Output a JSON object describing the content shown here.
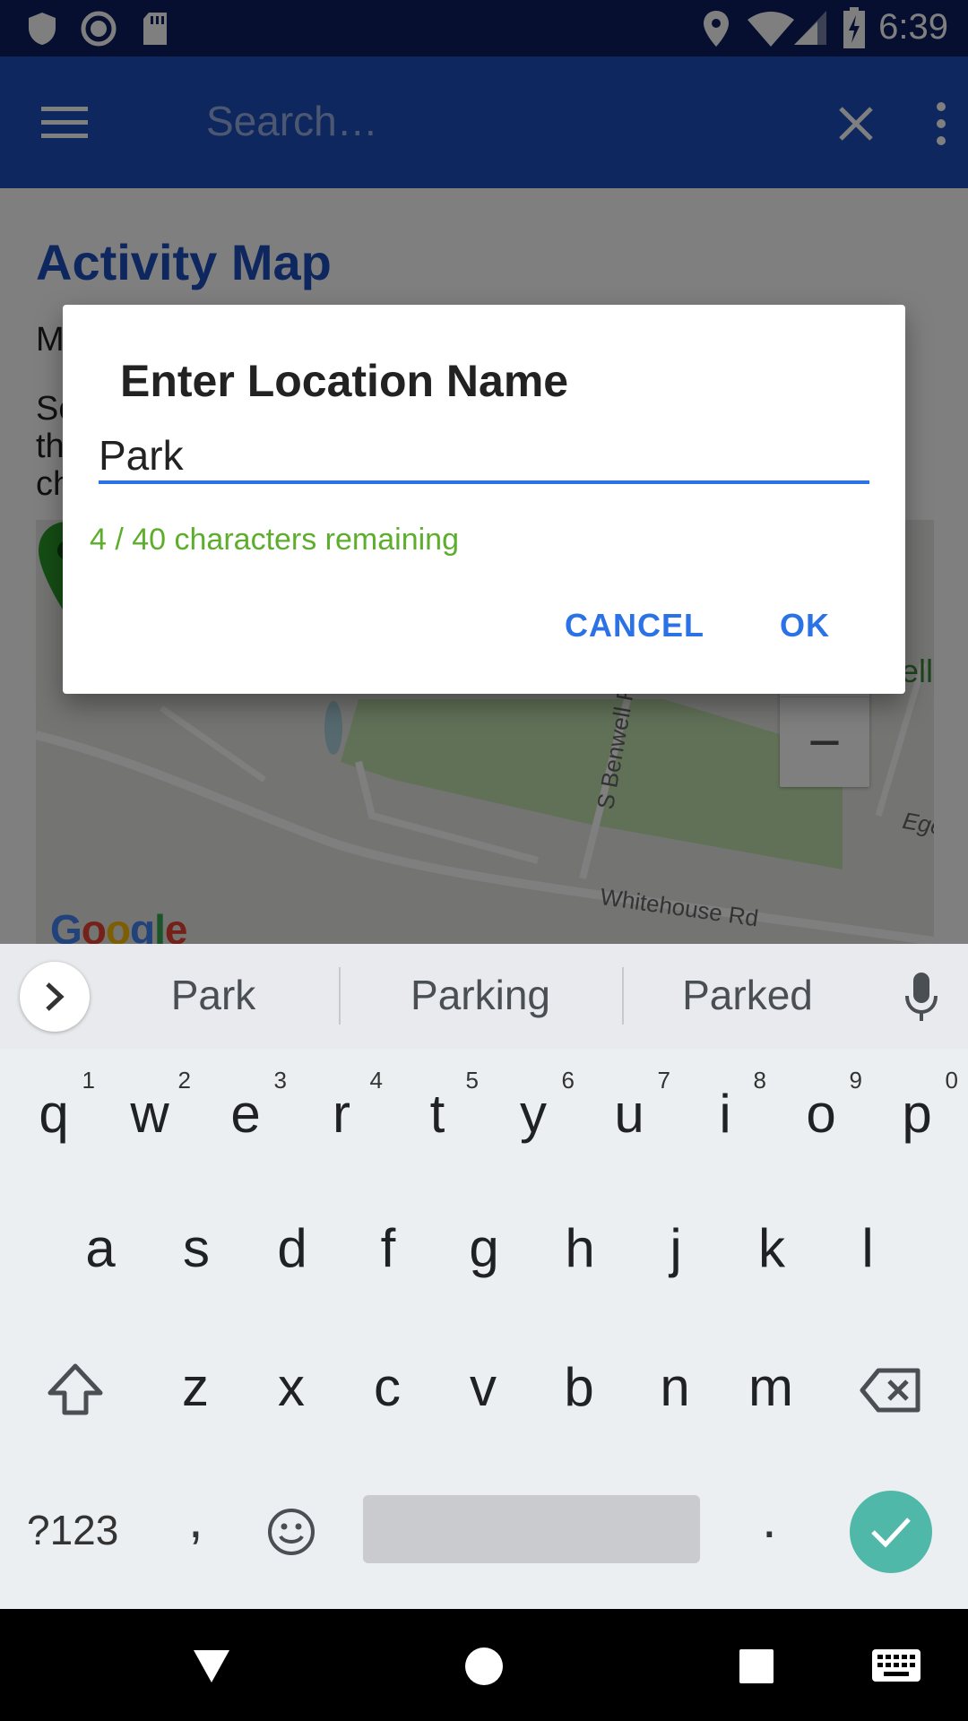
{
  "status_bar": {
    "time": "6:39",
    "left_icons": [
      "shield-icon",
      "record-icon",
      "sd-card-icon"
    ],
    "right_icons": [
      "location-icon",
      "wifi-icon",
      "cell-signal-icon",
      "battery-charging-icon"
    ]
  },
  "app_bar": {
    "menu_icon": "menu-icon",
    "search_placeholder": "Search…",
    "clear_icon": "close-icon",
    "overflow_icon": "more-vert-icon",
    "color": "#1e4fbe"
  },
  "page": {
    "title": "Activity Map",
    "intro_line": "M",
    "intro_paragraph": "Se\nth\nch"
  },
  "map": {
    "roads": [
      "S Benwell Rd",
      "Whitehouse Rd",
      "Egert"
    ],
    "top_right_label": "ell",
    "zoom_in": "+",
    "zoom_out": "−",
    "logo": [
      "G",
      "o",
      "o",
      "g",
      "l",
      "e"
    ],
    "marker_color": "#1f7a1f"
  },
  "dialog": {
    "title": "Enter Location Name",
    "field_value": "Park",
    "counter": "4 / 40 characters remaining",
    "cancel": "CANCEL",
    "ok": "OK",
    "accent": "#2a72e6",
    "counter_color": "#5dae2d"
  },
  "keyboard": {
    "suggestions": [
      "Park",
      "Parking",
      "Parked"
    ],
    "row1": [
      {
        "ch": "q",
        "hint": "1"
      },
      {
        "ch": "w",
        "hint": "2"
      },
      {
        "ch": "e",
        "hint": "3"
      },
      {
        "ch": "r",
        "hint": "4"
      },
      {
        "ch": "t",
        "hint": "5"
      },
      {
        "ch": "y",
        "hint": "6"
      },
      {
        "ch": "u",
        "hint": "7"
      },
      {
        "ch": "i",
        "hint": "8"
      },
      {
        "ch": "o",
        "hint": "9"
      },
      {
        "ch": "p",
        "hint": "0"
      }
    ],
    "row2": [
      "a",
      "s",
      "d",
      "f",
      "g",
      "h",
      "j",
      "k",
      "l"
    ],
    "row3": [
      "z",
      "x",
      "c",
      "v",
      "b",
      "n",
      "m"
    ],
    "symbols_key": "?123",
    "comma": ",",
    "period": ".",
    "enter_color": "#4fb8a9"
  },
  "nav_bar": {
    "icons": [
      "back-icon",
      "home-icon",
      "recents-icon",
      "keyboard-switch-icon"
    ]
  }
}
